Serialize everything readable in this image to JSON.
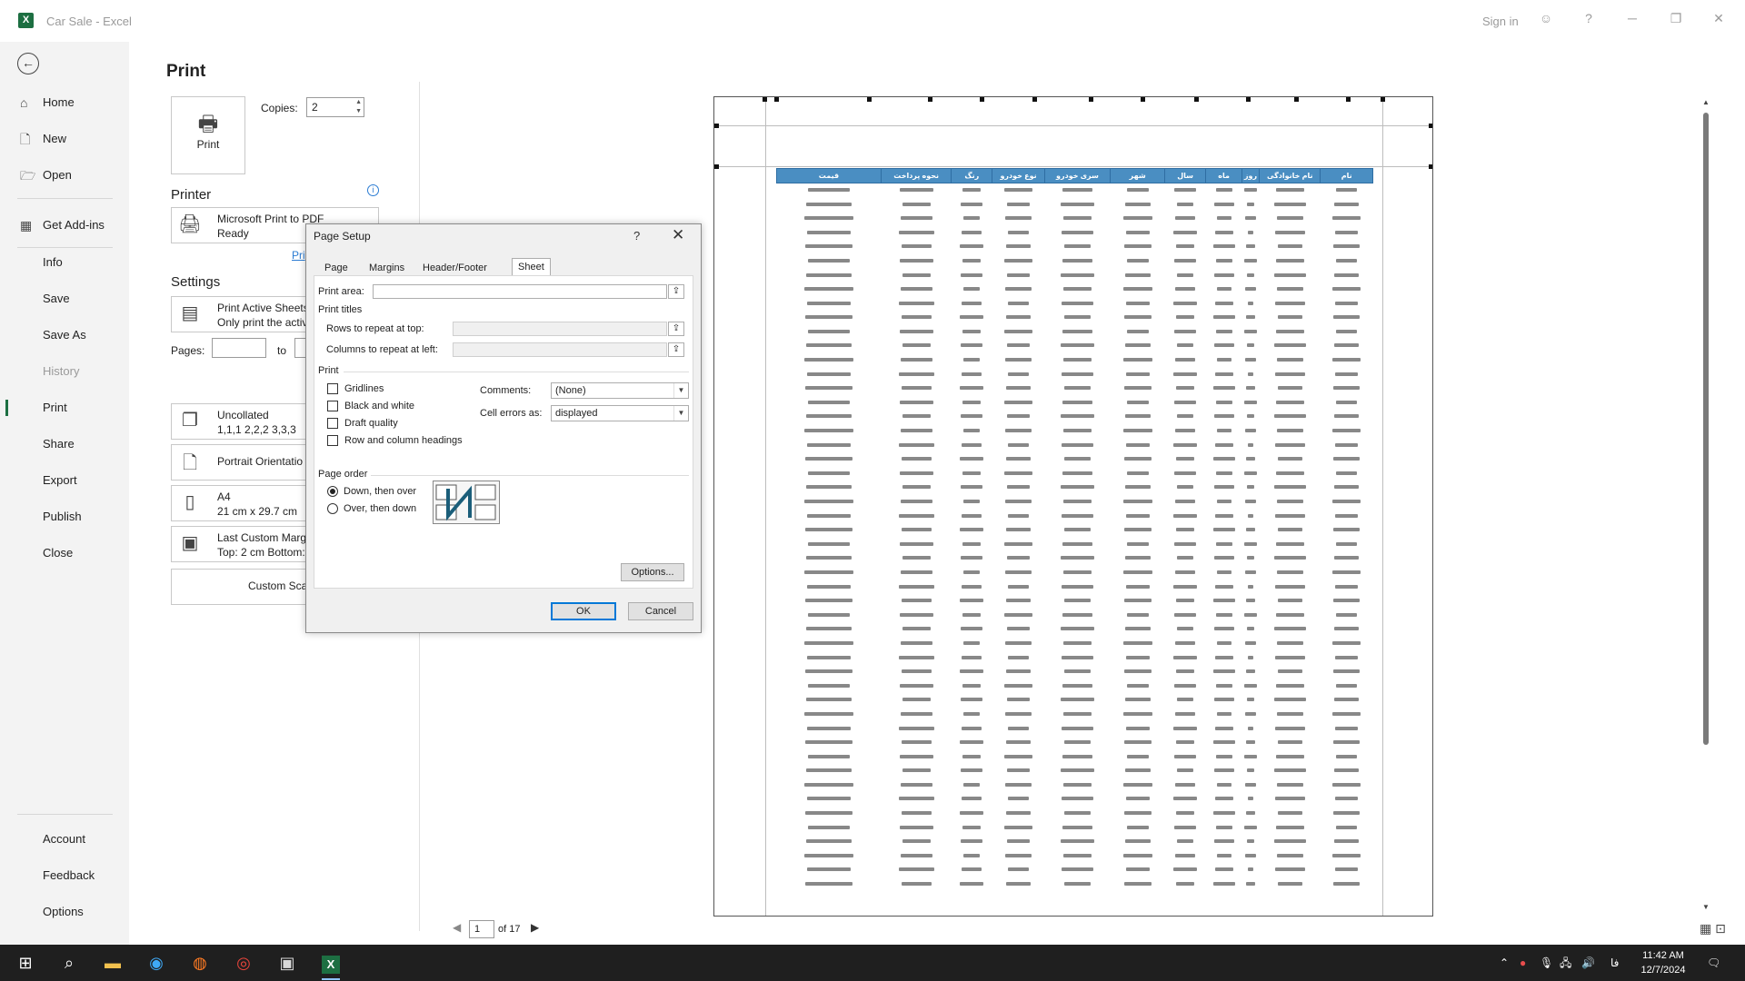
{
  "window": {
    "title": "Car Sale  -  Excel",
    "signin": "Sign in",
    "help_glyph": "?",
    "minimize_glyph": "─",
    "restore_glyph": "❐",
    "close_glyph": "✕"
  },
  "nav": {
    "back_glyph": "←",
    "items": [
      {
        "label": "Home",
        "icon": "home-icon"
      },
      {
        "label": "New",
        "icon": "new-document-icon"
      },
      {
        "label": "Open",
        "icon": "folder-open-icon"
      },
      {
        "label": "Get Add-ins",
        "icon": "add-ins-icon"
      },
      {
        "label": "Info"
      },
      {
        "label": "Save"
      },
      {
        "label": "Save As"
      },
      {
        "label": "History"
      },
      {
        "label": "Print"
      },
      {
        "label": "Share"
      },
      {
        "label": "Export"
      },
      {
        "label": "Publish"
      },
      {
        "label": "Close"
      }
    ],
    "bottom": [
      {
        "label": "Account"
      },
      {
        "label": "Feedback"
      },
      {
        "label": "Options"
      }
    ]
  },
  "print": {
    "heading": "Print",
    "button_label": "Print",
    "copies_label": "Copies:",
    "copies_value": "2",
    "printer_title": "Printer",
    "printer_name": "Microsoft Print to PDF",
    "printer_status": "Ready",
    "printer_properties": "Pri",
    "settings_title": "Settings",
    "what_line1": "Print Active Sheets",
    "what_line2": "Only print the activ",
    "pages_label": "Pages:",
    "to_label": "to",
    "collate_line1": "Uncollated",
    "collate_line2": "1,1,1    2,2,2    3,3,3",
    "orientation": "Portrait Orientatio",
    "paper_line1": "A4",
    "paper_line2": "21 cm x 29.7 cm",
    "margins_line1": "Last Custom Marg",
    "margins_line2": "Top: 2 cm Bottom:",
    "scaling": "Custom Scaling"
  },
  "dialog": {
    "title": "Page Setup",
    "help": "?",
    "close": "✕",
    "tabs": [
      "Page",
      "Margins",
      "Header/Footer",
      "Sheet"
    ],
    "active_tab": "Sheet",
    "print_area_label": "Print area:",
    "print_titles_label": "Print titles",
    "rows_repeat_label": "Rows to repeat at top:",
    "cols_repeat_label": "Columns to repeat at left:",
    "print_group_label": "Print",
    "gridlines": "Gridlines",
    "black_white": "Black and white",
    "draft_quality": "Draft quality",
    "row_col_headings": "Row and column headings",
    "comments_label": "Comments:",
    "comments_value": "(None)",
    "cell_errors_label": "Cell errors as:",
    "cell_errors_value": "displayed",
    "page_order_label": "Page order",
    "down_then_over": "Down, then over",
    "over_then_down": "Over, then down",
    "options_btn": "Options...",
    "ok_btn": "OK",
    "cancel_btn": "Cancel"
  },
  "preview": {
    "headers": [
      "قیمت",
      "نحوه پرداخت",
      "رنگ",
      "نوع خودرو",
      "سری خودرو",
      "شهر",
      "سال",
      "ماه",
      "روز",
      "نام خانوادگی",
      "نام"
    ],
    "current_page": "1",
    "of_pages": "of 17",
    "header_color": "#4a8ec2"
  },
  "taskbar": {
    "time": "11:42 AM",
    "date": "12/7/2024",
    "lang": "فا"
  }
}
